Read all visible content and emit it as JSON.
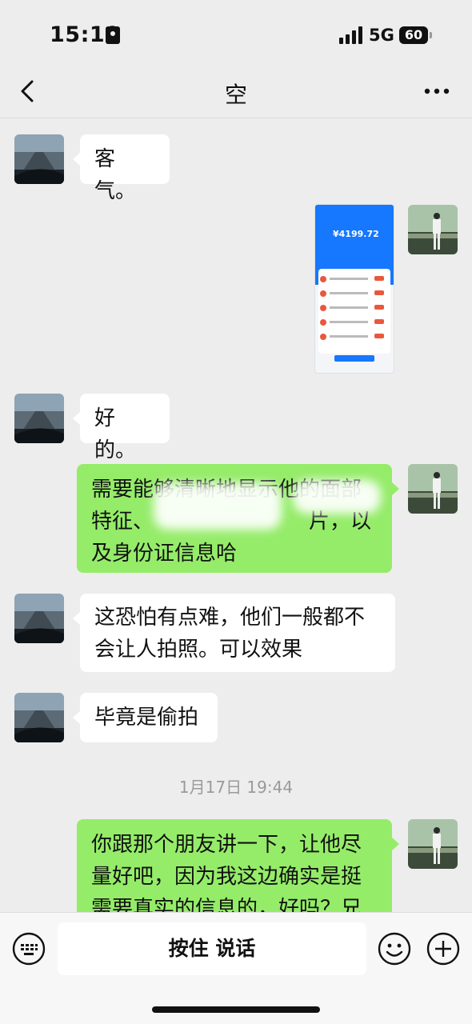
{
  "status_bar": {
    "time": "15:10",
    "network": "5G",
    "battery": "60"
  },
  "nav": {
    "title": "空"
  },
  "messages": [
    {
      "side": "left",
      "text": "客气。"
    },
    {
      "side": "right",
      "type": "image",
      "image": {
        "amount": "¥4199.72"
      }
    },
    {
      "side": "left",
      "text": "好的。"
    },
    {
      "side": "right",
      "line1_a": "需要能够清晰地显示他的面部",
      "line2_a": "特征、",
      "line2_b": "片，以",
      "line3": "及身份证信息哈"
    },
    {
      "side": "left",
      "line1": "这恐怕有点难，他们一般都不",
      "line2": "会让人拍照。可以效果"
    },
    {
      "side": "left",
      "text": "毕竟是偷拍"
    },
    {
      "side": "right",
      "line1": "你跟那个朋友讲一下，让他尽",
      "line2": "量好吧，因为我这边确实是挺",
      "line3": "需要真实的信息的，好吗？兄"
    }
  ],
  "timestamp": "1月17日 19:44",
  "input_bar": {
    "voice_label": "按住 说话"
  },
  "colors": {
    "background": "#ededed",
    "bubble_right": "#95ec69",
    "bubble_left": "#ffffff",
    "accent_blue": "#1677ff"
  },
  "icons": [
    "back-icon",
    "more-icon",
    "keyboard-icon",
    "emoji-icon",
    "plus-icon"
  ]
}
